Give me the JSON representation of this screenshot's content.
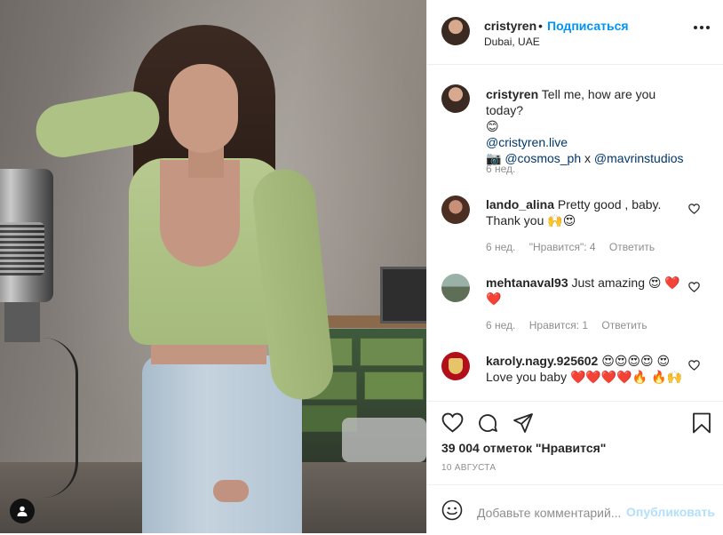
{
  "post": {
    "author": "cristyren",
    "follow_label": "Подписаться",
    "location": "Dubai, UAE",
    "more_icon": "more-horizontal-icon"
  },
  "caption": {
    "username": "cristyren",
    "text": "Tell me, how are you today?",
    "emoji": "😊",
    "link_main": "@cristyren.live",
    "camera_emoji": "📷",
    "link_photographer": "@cosmos_ph",
    "separator": "x",
    "link_studio": "@mavrinstudios",
    "time": "6 нед."
  },
  "comments": [
    {
      "username": "lando_alina",
      "text": "Pretty good , baby. Thank you 🙌😍",
      "time": "6 нед.",
      "likes": "\"Нравится\": 4",
      "reply": "Ответить"
    },
    {
      "username": "mehtanaval93",
      "text": "Just amazing 😍 ❤️❤️",
      "time": "6 нед.",
      "likes": "Нравится: 1",
      "reply": "Ответить"
    },
    {
      "username": "karoly.nagy.925602",
      "text": "😍😍😍😍 😍Love you baby ❤️❤️❤️❤️🔥 🔥🙌"
    }
  ],
  "actions": {
    "like_icon": "heart-icon",
    "comment_icon": "comment-icon",
    "share_icon": "share-icon",
    "save_icon": "bookmark-icon"
  },
  "likes_count": "39 004 отметок \"Нравится\"",
  "post_date": "10 АВГУСТА",
  "add_comment": {
    "placeholder": "Добавьте комментарий...",
    "publish_label": "Опубликовать",
    "emoji_icon": "smile-icon"
  },
  "photo": {
    "tag_icon": "user-tag-icon"
  },
  "colors": {
    "link_blue": "#0095f6",
    "mention": "#00376b",
    "muted": "#8e8e8e",
    "publish_disabled": "#b2dffc"
  }
}
